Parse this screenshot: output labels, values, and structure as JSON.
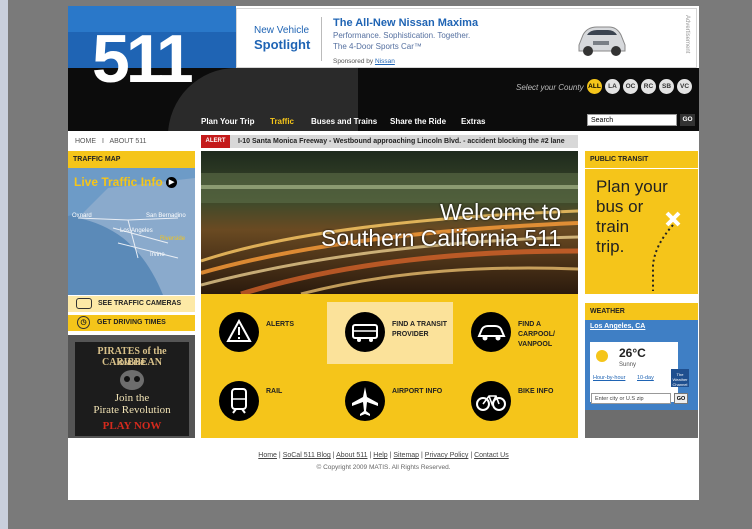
{
  "logo": "511",
  "ad": {
    "label_small": "New Vehicle",
    "label_big": "Spotlight",
    "headline": "The All-New Nissan Maxima",
    "line1": "Performance. Sophistication. Together.",
    "line2": "The 4-Door Sports Car™",
    "sponsored_prefix": "Sponsored by",
    "sponsor": "Nissan",
    "side_label": "Advertisement"
  },
  "county": {
    "label": "Select your County",
    "options": [
      "ALL",
      "LA",
      "OC",
      "RC",
      "SB",
      "VC"
    ]
  },
  "nav": {
    "items": [
      "Plan Your Trip",
      "Traffic",
      "Buses and Trains",
      "Share the Ride",
      "Extras"
    ],
    "active_color": "#f5c51a"
  },
  "search": {
    "placeholder": "Search",
    "go": "GO"
  },
  "breadcrumb": {
    "home": "HOME",
    "sep": "I",
    "about": "ABOUT 511"
  },
  "alert": {
    "tag": "ALERT",
    "text": "I-10 Santa Monica Freeway - Westbound approaching Lincoln Blvd. - accident blocking the #2 lane"
  },
  "hero": {
    "line1": "Welcome to",
    "line2": "Southern California 511"
  },
  "services": [
    {
      "label": "ALERTS",
      "icon": "alert-icon"
    },
    {
      "label": "FIND A TRANSIT PROVIDER",
      "icon": "bus-icon"
    },
    {
      "label": "FIND A CARPOOL/ VANPOOL",
      "icon": "carpool-icon"
    },
    {
      "label": "RAIL",
      "icon": "train-icon"
    },
    {
      "label": "AIRPORT INFO",
      "icon": "airplane-icon"
    },
    {
      "label": "BIKE INFO",
      "icon": "bike-icon"
    }
  ],
  "traffic_map": {
    "header": "TRAFFIC MAP",
    "title": "Live Traffic Info",
    "cities": [
      "Oxnard",
      "San Bernadino",
      "Los Angeles",
      "Riverside",
      "Irvine"
    ],
    "cameras": "SEE TRAFFIC CAMERAS",
    "driving": "GET DRIVING TIMES"
  },
  "promo": {
    "title1": "PIRATES of the CARIBBEAN",
    "title2": "ONLINE",
    "tagline1": "Join the",
    "tagline2": "Pirate Revolution",
    "cta": "PLAY NOW"
  },
  "public_transit": {
    "header": "PUBLIC TRANSIT",
    "text": [
      "Plan your",
      "bus or",
      "train",
      "trip."
    ]
  },
  "weather": {
    "header": "WEATHER",
    "location": "Los Angeles, CA",
    "temp": "26°C",
    "condition": "Sunny",
    "link1": "Hour-by-hour",
    "link2": "10-day",
    "badge": "The Weather Channel",
    "input_placeholder": "Enter city or U.S zip",
    "go": "GO"
  },
  "footer": {
    "links": [
      "Home",
      "SoCal 511 Blog",
      "About 511",
      "Help",
      "Sitemap",
      "Privacy Policy",
      "Contact Us"
    ],
    "copyright": "© Copyright 2009 MATIS. All Rights Reserved."
  }
}
